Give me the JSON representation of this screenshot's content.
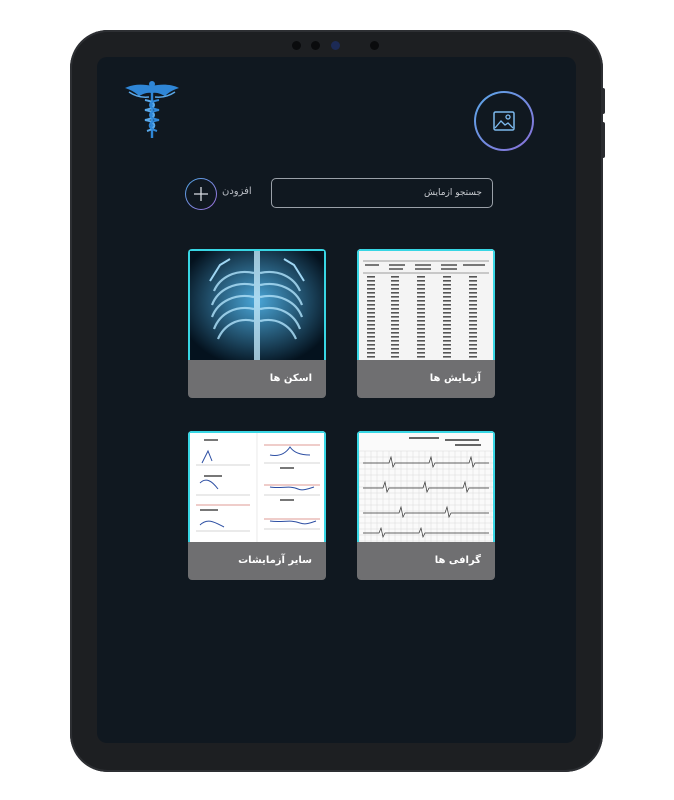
{
  "header": {
    "logo_icon": "caduceus-icon",
    "image_button_icon": "image-icon"
  },
  "toolbar": {
    "search_placeholder": "جستجو آزمایش",
    "add_label": "افزودن",
    "add_icon": "plus-icon"
  },
  "categories": [
    {
      "label": "آزمایش ها",
      "thumbnail": "lab-results-table"
    },
    {
      "label": "اسکن ها",
      "thumbnail": "chest-xray"
    },
    {
      "label": "گرافی ها",
      "thumbnail": "ecg-strip"
    },
    {
      "label": "سایر آزمایشات",
      "thumbnail": "test-graphs"
    }
  ],
  "colors": {
    "screen_bg": "#101820",
    "card_label_bg": "#6f6f71",
    "card_border": "#38d6e4",
    "accent_blue": "#2f86d6"
  }
}
